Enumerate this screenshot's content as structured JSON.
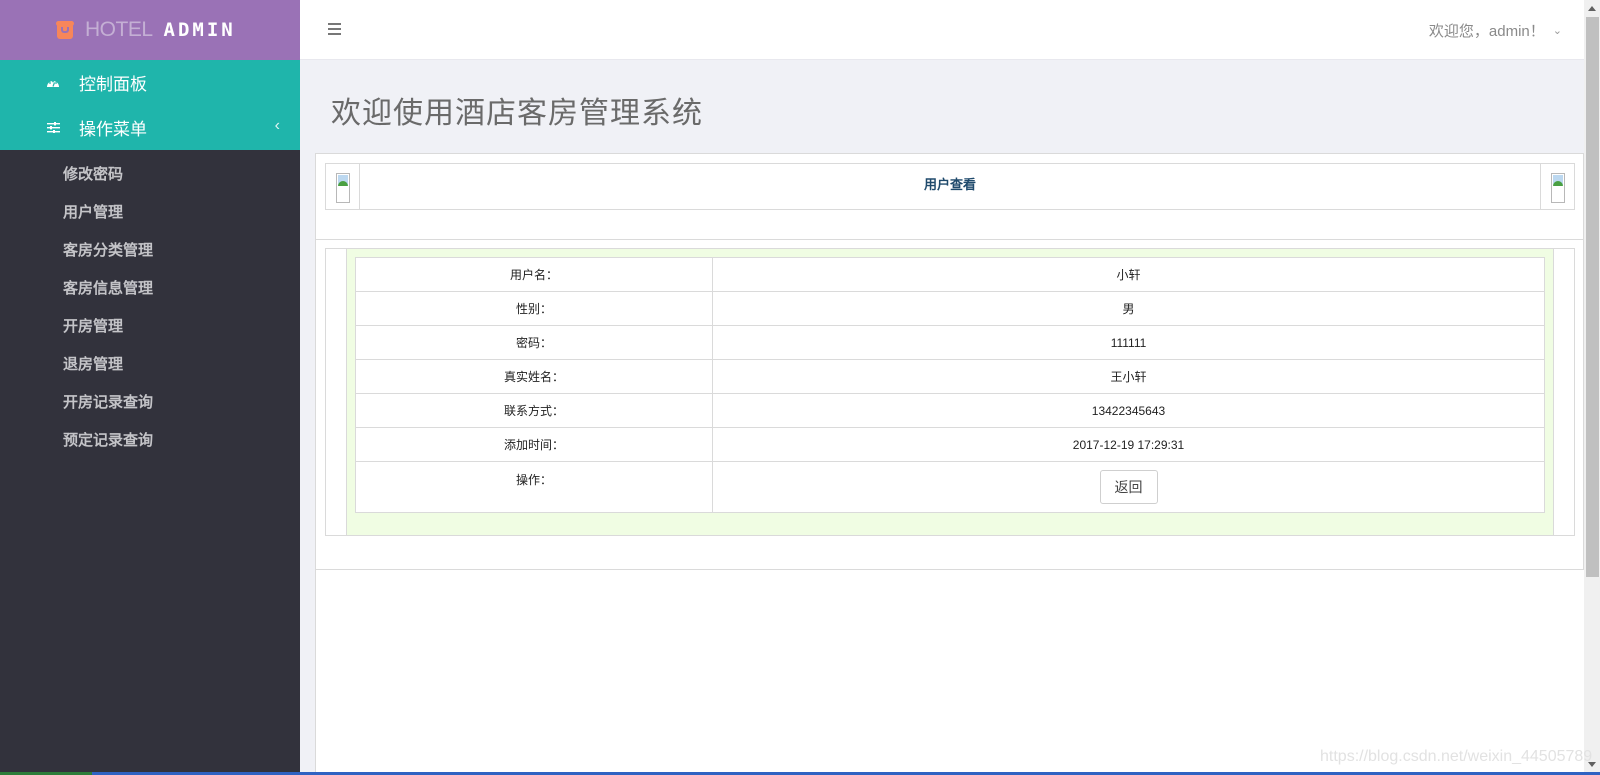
{
  "brand": {
    "icon": "paint-bucket-icon",
    "text_light": "HOTEL",
    "text_bold": "ADMIN"
  },
  "sidebar": {
    "top_items": [
      {
        "label": "控制面板",
        "icon": "dashboard-gauge-icon"
      },
      {
        "label": "操作菜单",
        "icon": "sliders-icon",
        "chevron": "‹"
      }
    ],
    "sub_items": [
      {
        "label": "修改密码"
      },
      {
        "label": "用户管理"
      },
      {
        "label": "客房分类管理"
      },
      {
        "label": "客房信息管理"
      },
      {
        "label": "开房管理"
      },
      {
        "label": "退房管理"
      },
      {
        "label": "开房记录查询"
      },
      {
        "label": "预定记录查询"
      }
    ]
  },
  "header": {
    "menu_icon": "hamburger-icon",
    "user_greeting": "欢迎您，admin！",
    "caret": "⌄"
  },
  "main": {
    "page_title": "欢迎使用酒店客房管理系统",
    "section_title": "用户查看",
    "details": [
      {
        "label": "用户名：",
        "value": "小轩"
      },
      {
        "label": "性别：",
        "value": "男"
      },
      {
        "label": "密码：",
        "value": "111111"
      },
      {
        "label": "真实姓名：",
        "value": "王小轩"
      },
      {
        "label": "联系方式：",
        "value": "13422345643"
      },
      {
        "label": "添加时间：",
        "value": "2017-12-19 17:29:31"
      }
    ],
    "ops_label": "操作：",
    "back_button": "返回"
  },
  "watermark": "https://blog.csdn.net/weixin_44505789",
  "colors": {
    "brand_purple": "#9a72b6",
    "nav_teal": "#1fb5ab",
    "sidebar_dark": "#32323c",
    "detail_bg_green": "#f0fde3",
    "section_title_blue": "#1f4a6c"
  }
}
